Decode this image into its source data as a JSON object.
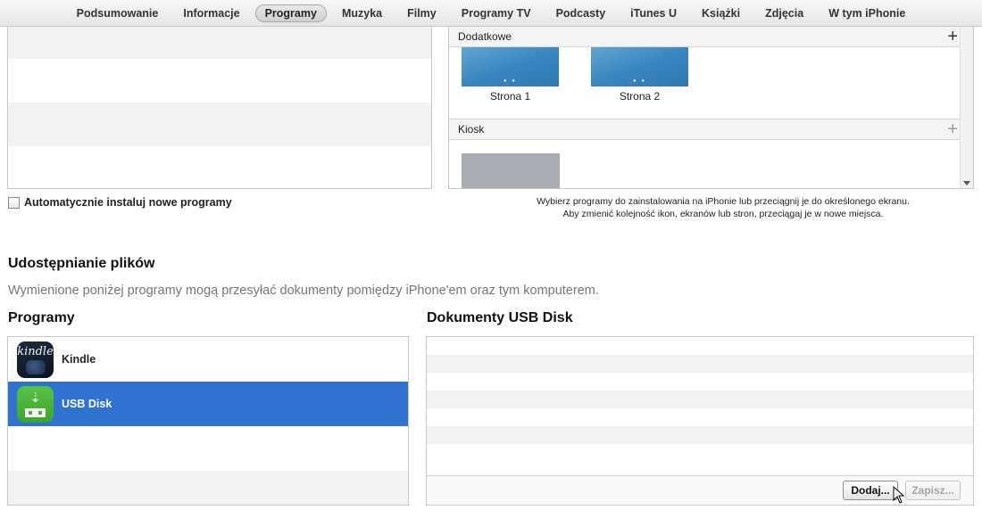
{
  "tabs": [
    {
      "label": "Podsumowanie",
      "active": false
    },
    {
      "label": "Informacje",
      "active": false
    },
    {
      "label": "Programy",
      "active": true
    },
    {
      "label": "Muzyka",
      "active": false
    },
    {
      "label": "Filmy",
      "active": false
    },
    {
      "label": "Programy TV",
      "active": false
    },
    {
      "label": "Podcasty",
      "active": false
    },
    {
      "label": "iTunes U",
      "active": false
    },
    {
      "label": "Książki",
      "active": false
    },
    {
      "label": "Zdjęcia",
      "active": false
    },
    {
      "label": "W tym iPhonie",
      "active": false
    }
  ],
  "home_screens": {
    "dodatkowe_label": "Dodatkowe",
    "pages": [
      {
        "label": "Strona 1"
      },
      {
        "label": "Strona 2"
      }
    ],
    "kiosk_label": "Kiosk",
    "add_symbol": "+"
  },
  "auto_install": {
    "label": "Automatycznie instaluj nowe programy",
    "checked": false
  },
  "hint": {
    "line1": "Wybierz programy do zainstalowania na iPhonie lub przeciągnij je do określonego ekranu.",
    "line2": "Aby zmienić kolejność ikon, ekranów lub stron, przeciągaj je w nowe miejsca."
  },
  "file_sharing": {
    "heading": "Udostępnianie plików",
    "description": "Wymienione poniżej programy mogą przesyłać dokumenty pomiędzy iPhone'em oraz tym komputerem.",
    "apps_title": "Programy",
    "apps": [
      {
        "name": "Kindle",
        "icon": "kindle-icon",
        "selected": false
      },
      {
        "name": "USB Disk",
        "icon": "usb-disk-icon",
        "selected": true
      }
    ],
    "docs_title": "Dokumenty USB Disk",
    "add_button": "Dodaj...",
    "save_button": "Zapisz..."
  },
  "colors": {
    "selection": "#2f72d0",
    "tab_active_bg": "#d6d6d6"
  }
}
